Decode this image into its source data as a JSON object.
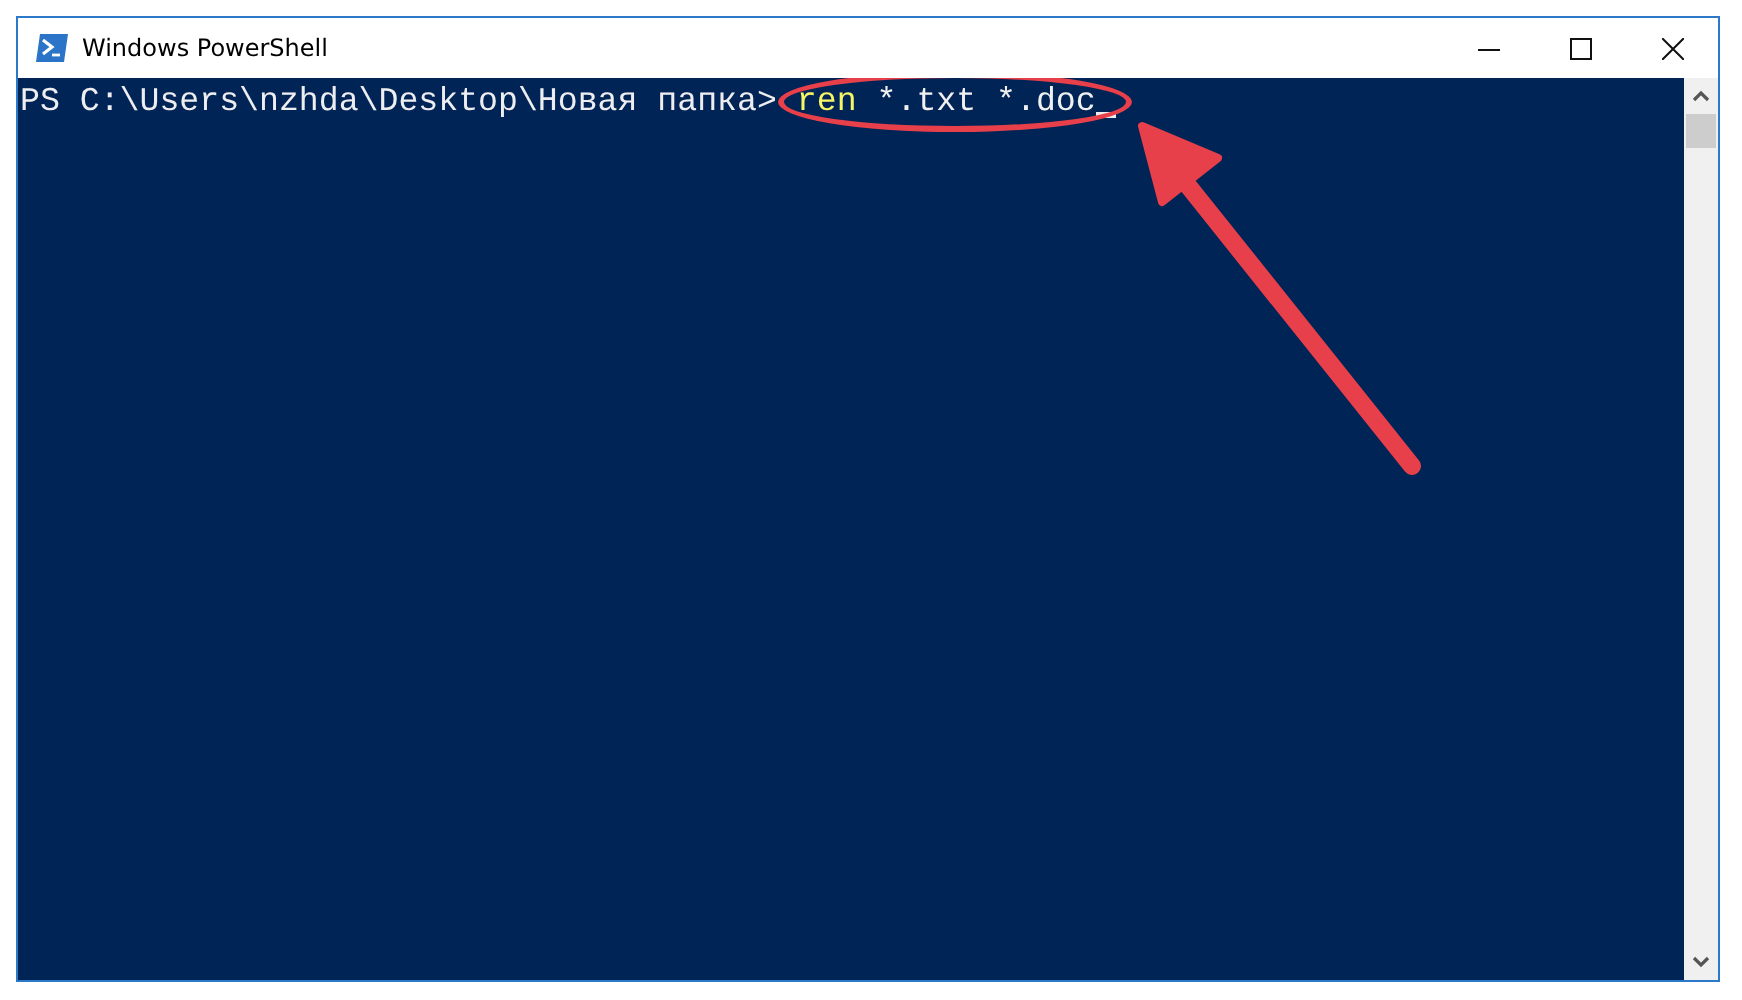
{
  "window": {
    "title": "Windows PowerShell"
  },
  "console": {
    "prompt": "PS C:\\Users\\nzhda\\Desktop\\Новая папка>",
    "command": [
      {
        "kind": "cmdlet",
        "text": "ren"
      },
      {
        "kind": "argument",
        "text": "*.txt *.doc"
      }
    ],
    "cursor_visible": true
  }
}
